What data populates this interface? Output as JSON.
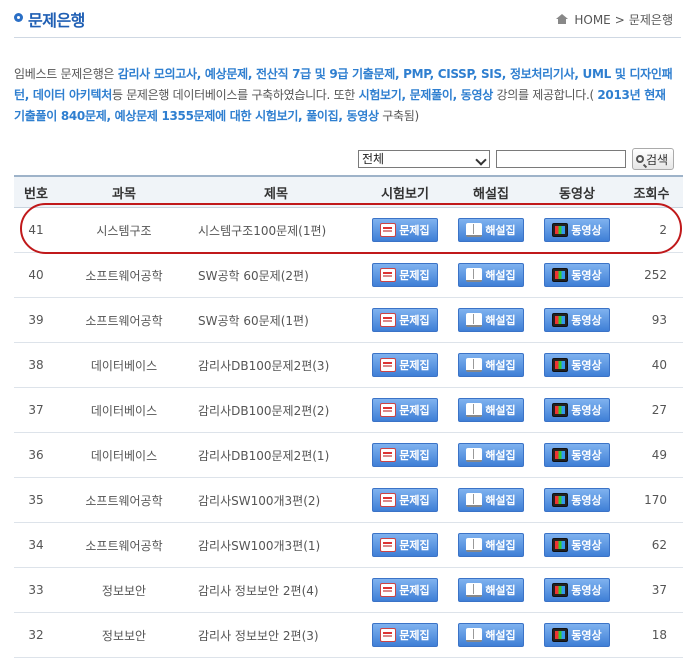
{
  "header": {
    "title": "문제은행",
    "breadcrumb": [
      "HOME",
      "문제은행"
    ]
  },
  "intro": [
    {
      "t": "임베스트 문제은행은 ",
      "hl": false
    },
    {
      "t": "감리사 모의고사, 예상문제, 전산직 7급 및 9급 기출문제, PMP, CISSP, SIS, 정보처리기사, UML 및 디자인패턴, 데이터 아키텍처",
      "hl": true
    },
    {
      "t": "등 문제은행 데이터베이스를 구축하였습니다. 또한 ",
      "hl": false
    },
    {
      "t": "시험보기, 문제풀이, 동영상",
      "hl": true
    },
    {
      "t": " 강의를 제공합니다.( ",
      "hl": false
    },
    {
      "t": "2013년 현재 기출풀이 840문제, 예상문제 1355문제에 대한 시험보기, 풀이집, 동영상",
      "hl": true
    },
    {
      "t": " 구축됨)",
      "hl": false
    }
  ],
  "search": {
    "select_value": "전체",
    "input_value": "",
    "button_label": "검색"
  },
  "columns": [
    "번호",
    "과목",
    "제목",
    "시험보기",
    "해설집",
    "동영상",
    "조회수"
  ],
  "buttons": {
    "exam": "문제집",
    "solution": "해설집",
    "video": "동영상"
  },
  "rows": [
    {
      "no": "41",
      "subject": "시스템구조",
      "title": "시스템구조100문제(1편)",
      "views": "2"
    },
    {
      "no": "40",
      "subject": "소프트웨어공학",
      "title": "SW공학 60문제(2편)",
      "views": "252"
    },
    {
      "no": "39",
      "subject": "소프트웨어공학",
      "title": "SW공학 60문제(1편)",
      "views": "93"
    },
    {
      "no": "38",
      "subject": "데이터베이스",
      "title": "감리사DB100문제2편(3)",
      "views": "40"
    },
    {
      "no": "37",
      "subject": "데이터베이스",
      "title": "감리사DB100문제2편(2)",
      "views": "27"
    },
    {
      "no": "36",
      "subject": "데이터베이스",
      "title": "감리사DB100문제2편(1)",
      "views": "49"
    },
    {
      "no": "35",
      "subject": "소프트웨어공학",
      "title": "감리사SW100개3편(2)",
      "views": "170"
    },
    {
      "no": "34",
      "subject": "소프트웨어공학",
      "title": "감리사SW100개3편(1)",
      "views": "62"
    },
    {
      "no": "33",
      "subject": "정보보안",
      "title": "감리사 정보보안 2편(4)",
      "views": "37"
    },
    {
      "no": "32",
      "subject": "정보보안",
      "title": "감리사 정보보안 2편(3)",
      "views": "18"
    }
  ]
}
